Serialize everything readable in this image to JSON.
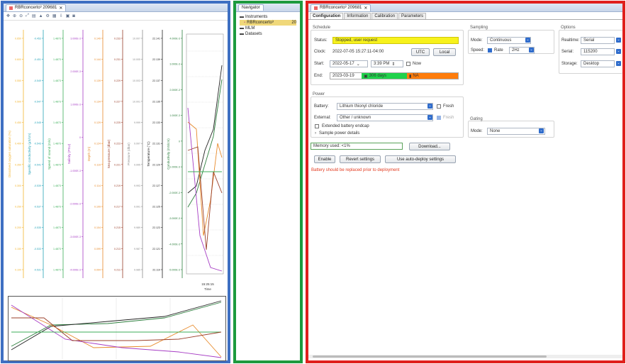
{
  "left_panel": {
    "tab_title": "RBRconcerto³ 209681",
    "axes": [
      {
        "label": "Dissolved oxygen saturation (%)",
        "color": "#f2b531",
        "ticks": [
          "0.650",
          "0.600",
          "0.550",
          "0.500",
          "0.450",
          "0.400",
          "0.350",
          "0.300",
          "0.250",
          "0.200",
          "0.150",
          "0.100"
        ]
      },
      {
        "label": "Specific conductivity (µS/cm)",
        "color": "#27a3b8",
        "ticks": [
          "-0.453",
          "-0.451",
          "-0.549",
          "-0.547",
          "-0.545",
          "-0.543",
          "-0.541",
          "-0.539",
          "-0.537",
          "-0.535",
          "-0.533",
          "-0.531"
        ]
      },
      {
        "label": "Speed of sound (m/s)",
        "color": "#3cae58",
        "ticks": [
          "1.4873",
          "1.4873",
          "1.4873",
          "1.4873",
          "1.4873",
          "1.4873",
          "1.4873",
          "1.4873",
          "1.4873",
          "1.4873",
          "1.4873",
          "1.4873"
        ]
      },
      {
        "label": "Salinity (PSU)",
        "color": "#a63cc4",
        "ticks": [
          "3.000E-3",
          "2.000E-3",
          "1.000E-3",
          "0",
          "-1.000E-3",
          "-2.000E-3",
          "-3.000E-3",
          "-4.000E-3"
        ]
      },
      {
        "label": "Depth (m)",
        "color": "#e78a2a",
        "ticks": [
          "0.149",
          "0.144",
          "0.139",
          "0.134",
          "0.129",
          "0.124",
          "0.119",
          "0.114",
          "0.109",
          "0.104",
          "0.099",
          "0.094"
        ]
      },
      {
        "label": "Sea pressure (dbar)",
        "color": "#9a3f2a",
        "ticks": [
          "0.233",
          "0.231",
          "0.229",
          "0.227",
          "0.225",
          "0.223",
          "0.221",
          "0.219",
          "0.217",
          "0.215",
          "0.213",
          "0.211"
        ]
      },
      {
        "label": "Pressure (dbar)",
        "color": "#8c8c8c",
        "ticks": [
          "10.007",
          "10.005",
          "10.003",
          "10.001",
          "9.999",
          "9.997",
          "9.995",
          "9.993",
          "9.991",
          "9.989",
          "9.987",
          "9.985"
        ]
      },
      {
        "label": "Temperature (°C)",
        "color": "#222222",
        "ticks": [
          "22.141",
          "22.139",
          "22.137",
          "22.135",
          "22.133",
          "22.131",
          "22.129",
          "22.127",
          "22.125",
          "22.123",
          "22.121",
          "22.119"
        ]
      },
      {
        "label": "Conductivity (mS/cm)",
        "color": "#2d7f3e",
        "ticks": [
          "4.000E-3",
          "3.000E-3",
          "2.000E-3",
          "1.000E-3",
          "0",
          "-1.000E-3",
          "-2.000E-3",
          "-3.000E-3",
          "-4.000E-3",
          "-5.000E-3"
        ]
      }
    ],
    "time_tick": "15:25:15",
    "time_label": "Time"
  },
  "navigator": {
    "title": "Navigator",
    "items": [
      {
        "label": "Instruments",
        "indent": 0
      },
      {
        "label": "RBRconcerto³",
        "suffix": "20",
        "indent": 1,
        "selected": true
      },
      {
        "label": "MLM",
        "indent": 0
      },
      {
        "label": "Datasets",
        "indent": 0
      }
    ]
  },
  "right_panel": {
    "tab_title": "RBRconcerto³ 209681",
    "subtabs": [
      "Configuration",
      "Information",
      "Calibration",
      "Parameters"
    ],
    "schedule": {
      "title": "Schedule",
      "status_label": "Status:",
      "status_value": "Stopped, user request",
      "clock_label": "Clock:",
      "clock_value": "2022-07-05 15:27:11-04:00",
      "utc_button": "UTC",
      "local_button": "Local",
      "start_label": "Start:",
      "start_date": "2022-05-17",
      "start_time": "3:39 PM",
      "now_label": "Now",
      "end_label": "End:",
      "end_date": "2023-03-19",
      "end_days": "306 days",
      "end_na": "NA"
    },
    "power": {
      "title": "Power",
      "battery_label": "Battery:",
      "battery_value": "Lithium thionyl chloride",
      "fresh_label": "Fresh",
      "external_label": "External:",
      "external_value": "Other / unknown",
      "fresh2_label": "Fresh",
      "endcap_label": "Extended battery endcap",
      "sample_power_label": "Sample power details"
    },
    "memory_label": "Memory used: <1%",
    "download_button": "Download...",
    "enable_button": "Enable",
    "revert_button": "Revert settings",
    "auto_deploy_button": "Use auto-deploy settings",
    "warning": "Battery should be replaced prior to deployment",
    "sampling": {
      "title": "Sampling",
      "mode_label": "Mode:",
      "mode_value": "Continuous",
      "speed_label": "Speed:",
      "rate_label": "Rate",
      "rate_value": "2Hz"
    },
    "gating": {
      "title": "Gating",
      "mode_label": "Mode:",
      "mode_value": "None"
    },
    "options": {
      "title": "Options",
      "realtime_label": "Realtime:",
      "realtime_value": "Serial",
      "serial_label": "Serial:",
      "serial_value": "115200",
      "storage_label": "Storage:",
      "storage_value": "Desktop"
    }
  }
}
